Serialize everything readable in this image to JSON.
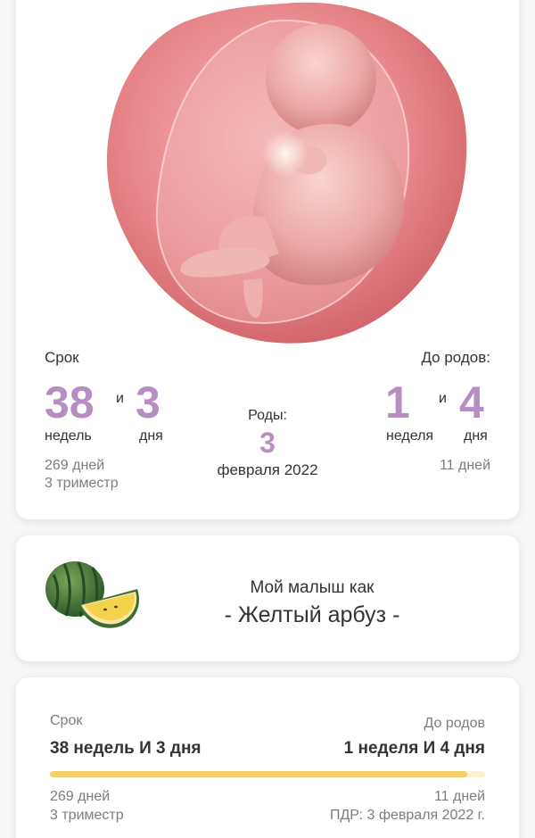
{
  "status": {
    "term_label": "Срок",
    "weeks": "38",
    "and_1": "и",
    "days": "3",
    "weeks_unit": "недель",
    "days_unit": "дня",
    "total_days": "269 дней",
    "trimester": "3 триместр",
    "birth_label": "Роды:",
    "birth_day": "3",
    "birth_month_year": "февраля 2022",
    "until_label": "До родов:",
    "until_weeks": "1",
    "and_2": "и",
    "until_days": "4",
    "until_weeks_unit": "неделя",
    "until_days_unit": "дня",
    "until_total_days": "11 дней"
  },
  "size_compare": {
    "title": "Мой малыш как",
    "fruit": "- Желтый арбуз -",
    "icon": "yellow-watermelon-icon"
  },
  "progress_card": {
    "term_label": "Срок",
    "term_value": "38 недель И 3 дня",
    "until_label": "До родов",
    "until_value": "1 неделя И 4 дня",
    "progress_fraction": 0.96,
    "total_days": "269 дней",
    "trimester": "3 триместр",
    "until_total_days": "11 дней",
    "due_date": "ПДР: 3 февраля 2022 г."
  },
  "colors": {
    "accent_purple": "#b68ec2",
    "progress_fill": "#f2d06b",
    "progress_track": "#fbf1cf"
  }
}
